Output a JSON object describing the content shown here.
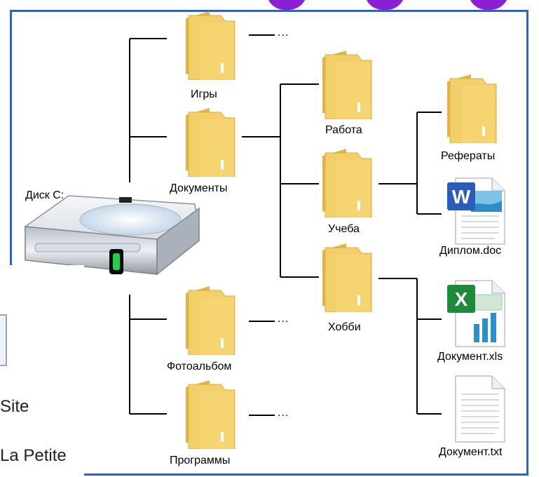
{
  "drive": {
    "label": "Диск С:"
  },
  "level1": [
    {
      "label": "Игры",
      "ellipsis": "..."
    },
    {
      "label": "Документы"
    },
    {
      "label": "Фотоальбом",
      "ellipsis": "..."
    },
    {
      "label": "Программы",
      "ellipsis": "..."
    }
  ],
  "level2": [
    {
      "label": "Работа"
    },
    {
      "label": "Учеба"
    },
    {
      "label": "Хобби"
    }
  ],
  "files": [
    {
      "label": "Рефераты",
      "icon": "folder-icon"
    },
    {
      "label": "Диплом.doc",
      "icon": "word-document-icon"
    },
    {
      "label": "Документ.xls",
      "icon": "excel-spreadsheet-icon"
    },
    {
      "label": "Документ.txt",
      "icon": "text-document-icon"
    }
  ],
  "overlay": {
    "line1": "Site",
    "line2": "La Petite"
  },
  "colors": {
    "frame": "#2a63c8",
    "folder": "#f3cf6a",
    "folder_dark": "#e2b44a",
    "word": "#2b5cb8",
    "excel": "#1f8a3b",
    "accent": "#8a1fd6"
  }
}
